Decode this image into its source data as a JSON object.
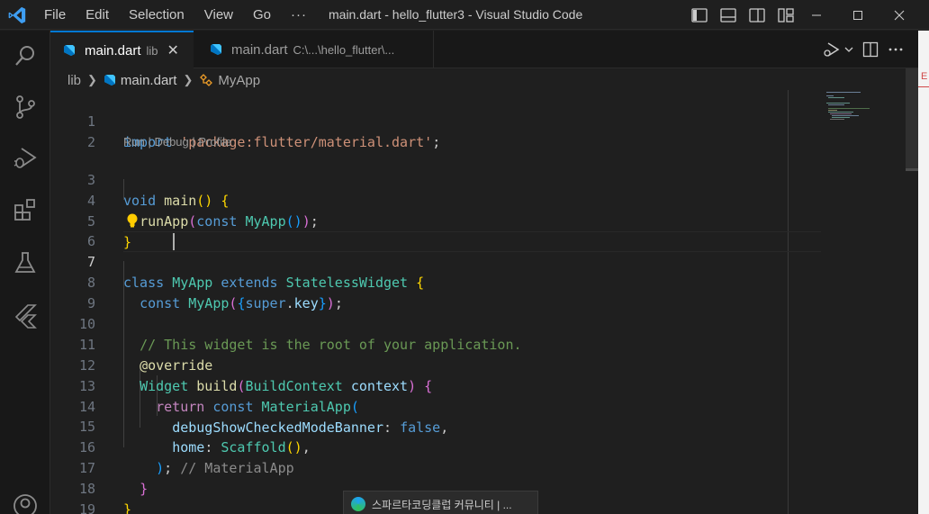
{
  "titlebar": {
    "menu": [
      "File",
      "Edit",
      "Selection",
      "View",
      "Go",
      "···"
    ],
    "title": "main.dart - hello_flutter3 - Visual Studio Code"
  },
  "tabs": [
    {
      "label": "main.dart",
      "description": "lib",
      "active": true,
      "close": "✕"
    },
    {
      "label": "main.dart",
      "description": "C:\\...\\hello_flutter\\...",
      "active": false
    }
  ],
  "breadcrumb": {
    "folder": "lib",
    "file": "main.dart",
    "symbol": "MyApp"
  },
  "editor": {
    "codelens": "Run | Debug | Profile",
    "line_numbers": [
      "1",
      "2",
      "3",
      "4",
      "5",
      "6",
      "7",
      "8",
      "9",
      "10",
      "11",
      "12",
      "13",
      "14",
      "15",
      "16",
      "17",
      "18",
      "19"
    ],
    "current_line": "7",
    "code": {
      "l1_import": "import",
      "l1_str": "'package:flutter/material.dart'",
      "l1_end": ";",
      "l3_void": "void",
      "l3_main": "main",
      "l3_paren": "()",
      "l3_brace": "{",
      "l4_runApp": "runApp",
      "l4_open": "(",
      "l4_const": "const",
      "l4_myapp": "MyApp",
      "l4_inner": "()",
      "l4_close": ")",
      "l4_semi": ";",
      "l5_brace": "}",
      "l7_class": "class",
      "l7_myapp": "MyApp",
      "l7_extends": "extends",
      "l7_widget": "StatelessWidget",
      "l7_brace": "{",
      "l8_const": "const",
      "l8_myapp": "MyApp",
      "l8_open": "(",
      "l8_obrace": "{",
      "l8_super": "super",
      "l8_dot": ".",
      "l8_key": "key",
      "l8_cbrace": "}",
      "l8_close": ")",
      "l8_semi": ";",
      "l10_comment": "// This widget is the root of your application.",
      "l11_override": "@override",
      "l12_widget": "Widget",
      "l12_build": "build",
      "l12_open": "(",
      "l12_ctx_type": "BuildContext",
      "l12_ctx": "context",
      "l12_close": ")",
      "l12_brace": "{",
      "l13_return": "return",
      "l13_const": "const",
      "l13_material": "MaterialApp",
      "l13_open": "(",
      "l14_prop": "debugShowCheckedModeBanner",
      "l14_colon": ":",
      "l14_false": "false",
      "l14_comma": ",",
      "l15_home": "home",
      "l15_colon": ":",
      "l15_scaffold": "Scaffold",
      "l15_parens": "()",
      "l15_comma": ",",
      "l16_close": ")",
      "l16_semi": ";",
      "l16_hint": "// MaterialApp",
      "l17_brace": "}",
      "l18_brace": "}"
    }
  },
  "toast": {
    "label": "스파르타코딩클럽 커뮤니티 | ..."
  },
  "right_strip": {
    "mark": "E"
  },
  "colors": {
    "accent": "#0078d4",
    "background": "#1f1f1f",
    "sidebar": "#181818"
  },
  "icons": {
    "activity": [
      "explorer-icon",
      "source-control-icon",
      "run-debug-icon",
      "extensions-icon",
      "testing-icon",
      "flutter-icon",
      "account-icon"
    ]
  }
}
